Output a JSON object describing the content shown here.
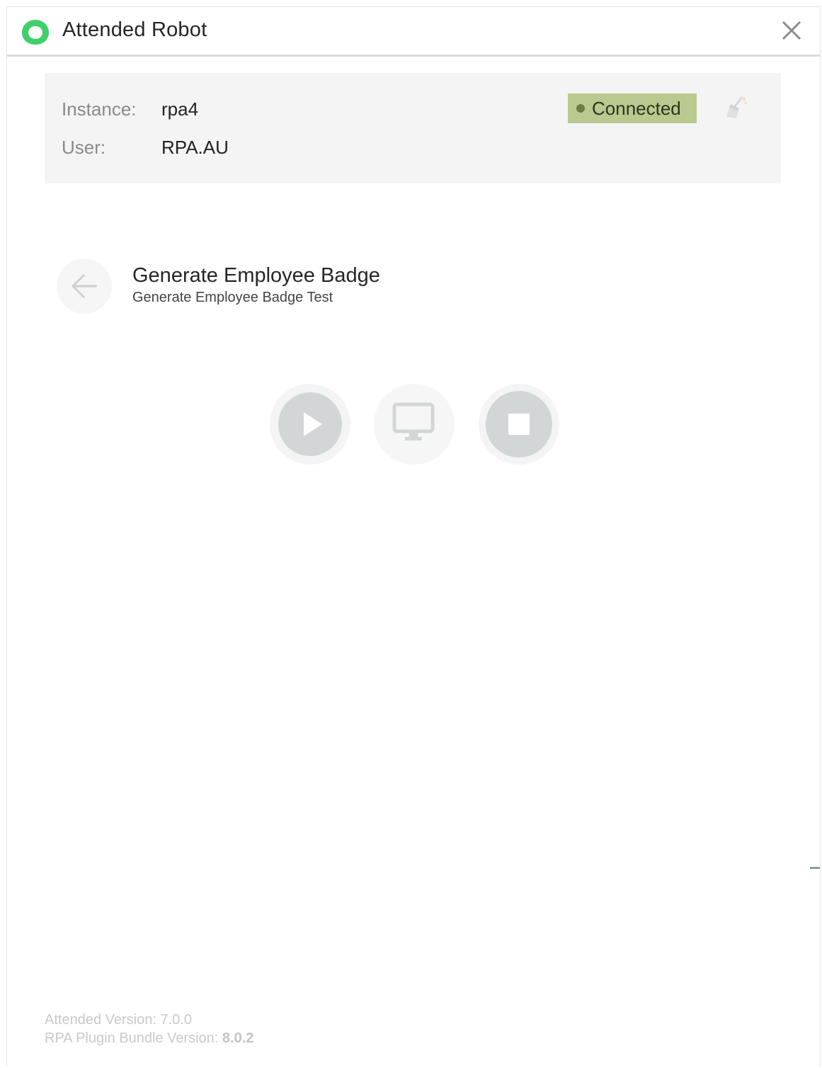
{
  "window": {
    "title": "Attended Robot",
    "logo_icon": "app-logo-icon",
    "close_icon": "close-icon"
  },
  "info": {
    "instance_label": "Instance:",
    "instance_value": "rpa4",
    "user_label": "User:",
    "user_value": "RPA.AU",
    "status": "Connected",
    "status_color": "#b9c98f",
    "settings_icon": "broom-icon"
  },
  "process": {
    "back_icon": "arrow-left-icon",
    "title": "Generate Employee Badge",
    "subtitle": "Generate Employee Badge Test"
  },
  "controls": {
    "play_icon": "play-icon",
    "display_icon": "monitor-icon",
    "stop_icon": "stop-icon"
  },
  "footer": {
    "attended_label": "Attended Version:",
    "attended_version": "7.0.0",
    "bundle_label": "RPA Plugin Bundle Version:",
    "bundle_version": "8.0.2"
  },
  "colors": {
    "accent_green": "#3ed06a",
    "disabled_gray": "#d3d6d6"
  }
}
